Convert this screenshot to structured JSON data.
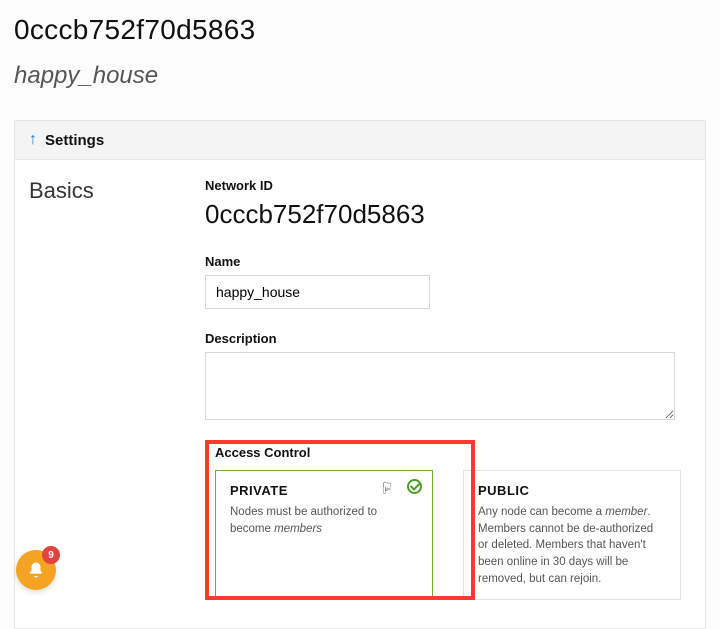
{
  "header": {
    "network_id": "0cccb752f70d5863",
    "network_name": "happy_house"
  },
  "settings": {
    "panel_label": "Settings",
    "section_label": "Basics",
    "network_id_label": "Network ID",
    "network_id_value": "0cccb752f70d5863",
    "name_label": "Name",
    "name_value": "happy_house",
    "description_label": "Description",
    "description_value": "",
    "access_control_label": "Access Control",
    "access": {
      "private": {
        "title": "PRIVATE",
        "desc_pre": "Nodes must be authorized to become ",
        "desc_em": "members",
        "selected": true
      },
      "public": {
        "title": "PUBLIC",
        "desc_pre": "Any node can become a ",
        "desc_em": "member",
        "desc_post": ". Members cannot be de-authorized or deleted. Members that haven't been online in 30 days will be removed, but can rejoin.",
        "selected": false
      }
    }
  },
  "notifications": {
    "count": "9"
  }
}
